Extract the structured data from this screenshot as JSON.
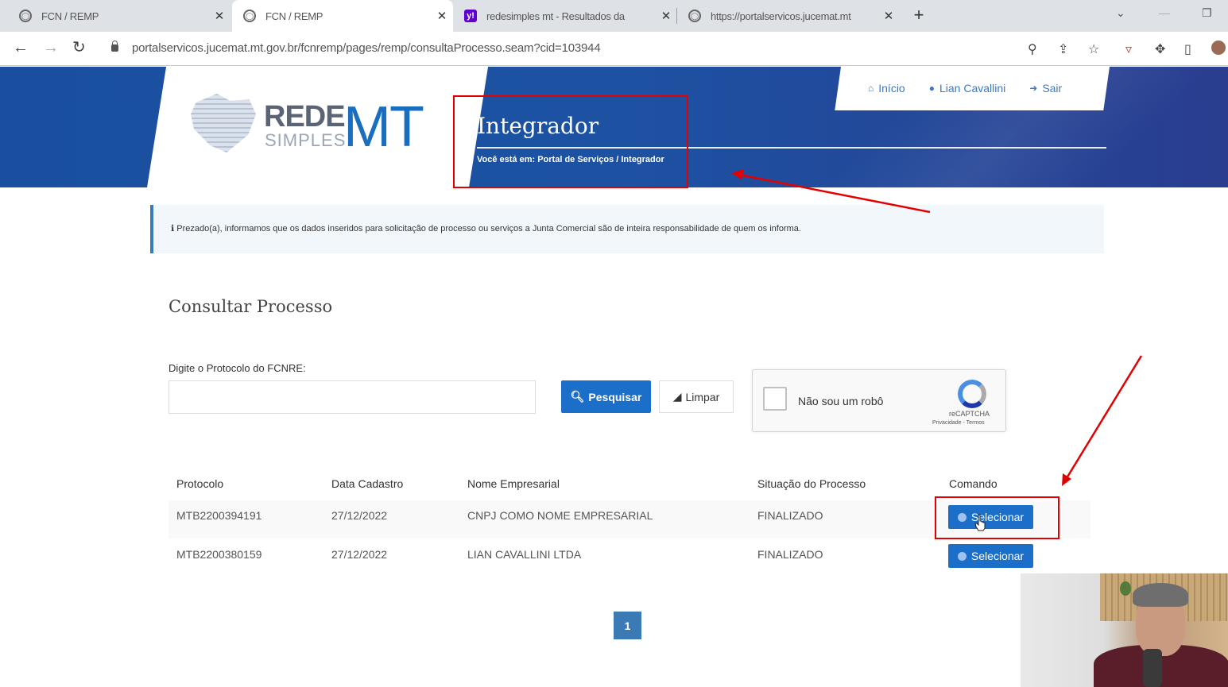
{
  "browser": {
    "tabs": [
      {
        "title": "FCN / REMP",
        "icon": "globe-icon"
      },
      {
        "title": "FCN / REMP",
        "icon": "globe-icon"
      },
      {
        "title": "redesimples mt - Resultados da",
        "icon": "yahoo-icon"
      },
      {
        "title": "https://portalservicos.jucemat.mt",
        "icon": "globe-icon"
      }
    ],
    "url": "portalservicos.jucemat.mt.gov.br/fcnremp/pages/remp/consultaProcesso.seam?cid=103944"
  },
  "header": {
    "logo_rede": "REDE",
    "logo_simples": "SIMPLES",
    "logo_mt": "MT",
    "nav": [
      {
        "label": "Início",
        "icon": "home-icon"
      },
      {
        "label": "Lian Cavallini",
        "icon": "user-icon"
      },
      {
        "label": "Sair",
        "icon": "sign-out-icon"
      }
    ],
    "title": "Integrador",
    "breadcrumb": "Você está em: Portal de Serviços / Integrador"
  },
  "info": {
    "text": "Prezado(a), informamos que os dados inseridos para solicitação de processo ou serviços a Junta Comercial são de inteira responsabilidade de quem os informa."
  },
  "consulta": {
    "heading": "Consultar Processo",
    "field_label": "Digite o Protocolo do FCNRE:",
    "field_value": "",
    "search_button": "Pesquisar",
    "clear_button": "Limpar"
  },
  "captcha": {
    "label": "Não sou um robô",
    "brand": "reCAPTCHA",
    "terms": "Privacidade - Termos"
  },
  "table": {
    "headers": [
      "Protocolo",
      "Data Cadastro",
      "Nome Empresarial",
      "Situação do Processo",
      "Comando"
    ],
    "rows": [
      {
        "protocolo": "MTB2200394191",
        "data": "27/12/2022",
        "nome": "CNPJ COMO NOME EMPRESARIAL",
        "situacao": "FINALIZADO",
        "comando": "Selecionar"
      },
      {
        "protocolo": "MTB2200380159",
        "data": "27/12/2022",
        "nome": "LIAN CAVALLINI LTDA",
        "situacao": "FINALIZADO",
        "comando": "Selecionar"
      }
    ]
  },
  "pagination": {
    "current": "1"
  },
  "colors": {
    "primary": "#1b6fc8",
    "banner": "#1d52a3",
    "annotation": "#e30000"
  }
}
